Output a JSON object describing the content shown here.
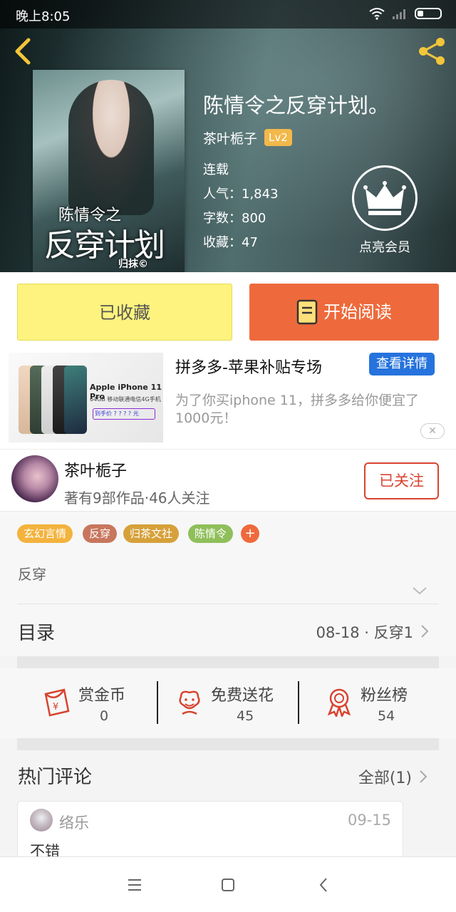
{
  "status": {
    "time": "晚上8:05"
  },
  "book": {
    "title": "陈情令之反穿计划。",
    "author": "茶叶栀子",
    "level": "Lv2",
    "status": "连载",
    "popularity": "人气：1,843",
    "word_count": "字数：800",
    "collections": "收藏：47",
    "vip_label": "点亮会员",
    "cover": {
      "title_small": "陈情令之",
      "title_big": "反穿计划",
      "author": "归抹©"
    }
  },
  "actions": {
    "collected_label": "已收藏",
    "read_label": "开始阅读"
  },
  "ad": {
    "title": "拼多多-苹果补贴专场",
    "detail_label": "查看详情",
    "description": "为了你买iphone 11，拼多多给你便宜了1000元！",
    "image_brand": "Apple iPhone 11 Pro",
    "image_sub": "64GB 移动联通电信4G手机",
    "image_price": "到手价 ? ? ? ? 元"
  },
  "author_card": {
    "name": "茶叶栀子",
    "stats": "著有9部作品·46人关注",
    "follow_label": "已关注"
  },
  "tags": [
    {
      "label": "玄幻言情",
      "color": "#f3b33d"
    },
    {
      "label": "反穿",
      "color": "#c8765e"
    },
    {
      "label": "归茶文社",
      "color": "#d6a13a"
    },
    {
      "label": "陈情令",
      "color": "#8fbf5a"
    }
  ],
  "tag_add": "+",
  "synopsis": "反穿",
  "toc": {
    "label": "目录",
    "latest": "08-18 · 反穿1"
  },
  "gifts": [
    {
      "label": "赏金币",
      "value": "0",
      "icon": "red-envelope-icon"
    },
    {
      "label": "免费送花",
      "value": "45",
      "icon": "flower-icon"
    },
    {
      "label": "粉丝榜",
      "value": "54",
      "icon": "ribbon-medal-icon"
    }
  ],
  "hot_comments": {
    "title": "热门评论",
    "all_label": "全部(1)"
  },
  "comment": {
    "user": "络乐",
    "date": "09-15",
    "text": "不错"
  },
  "colors": {
    "accent": "#ee6a3c",
    "collect_bg": "#fdf37e",
    "follow": "#d9432f",
    "ad_button": "#2673dd"
  }
}
